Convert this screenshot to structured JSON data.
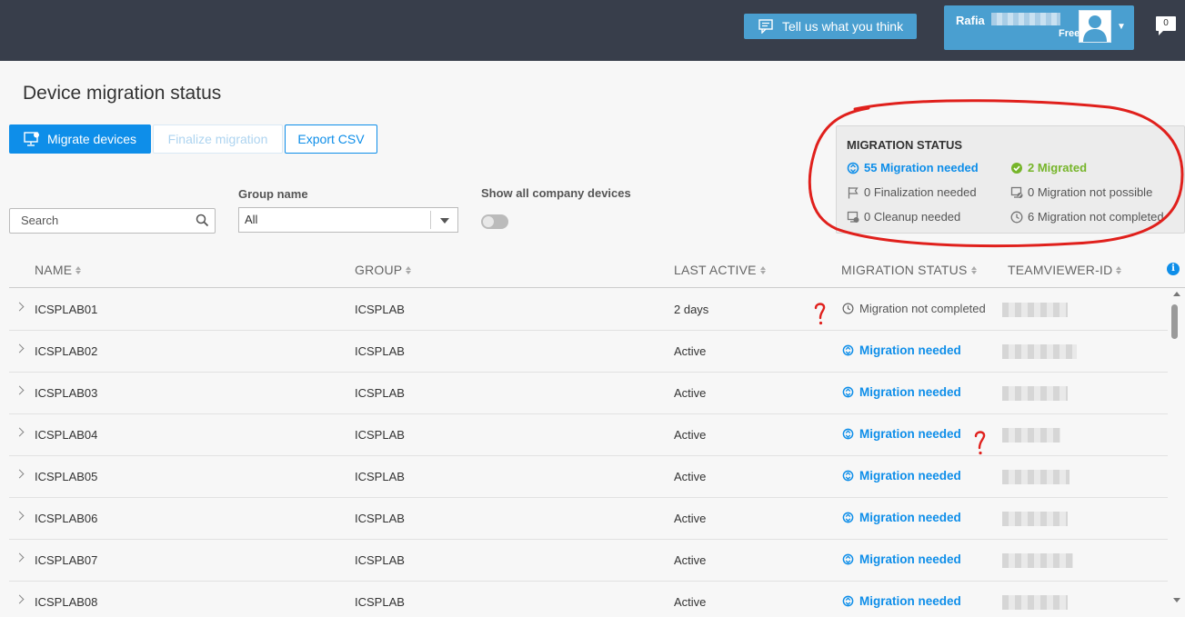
{
  "topbar": {
    "feedback_label": "Tell us what you think",
    "user_name": "Rafia",
    "plan": "Free",
    "notifications_count": "0"
  },
  "page": {
    "title": "Device migration status"
  },
  "actions": {
    "migrate_label": "Migrate devices",
    "finalize_label": "Finalize migration",
    "export_label": "Export CSV"
  },
  "filters": {
    "search_placeholder": "Search",
    "group_label": "Group name",
    "group_value": "All",
    "show_all_label": "Show all company devices",
    "show_all_on": false
  },
  "migration_status": {
    "title": "MIGRATION STATUS",
    "needed": "55 Migration needed",
    "migrated": "2 Migrated",
    "finalization": "0 Finalization needed",
    "not_possible": "0 Migration not possible",
    "cleanup": "0 Cleanup needed",
    "not_completed": "6 Migration not completed"
  },
  "table": {
    "columns": [
      "NAME",
      "GROUP",
      "LAST ACTIVE",
      "MIGRATION STATUS",
      "TEAMVIEWER-ID"
    ],
    "rows": [
      {
        "name": "ICSPLAB01",
        "group": "ICSPLAB",
        "last_active": "2 days",
        "status": "Migration not completed",
        "status_type": "notcomp"
      },
      {
        "name": "ICSPLAB02",
        "group": "ICSPLAB",
        "last_active": "Active",
        "status": "Migration needed",
        "status_type": "needed"
      },
      {
        "name": "ICSPLAB03",
        "group": "ICSPLAB",
        "last_active": "Active",
        "status": "Migration needed",
        "status_type": "needed"
      },
      {
        "name": "ICSPLAB04",
        "group": "ICSPLAB",
        "last_active": "Active",
        "status": "Migration needed",
        "status_type": "needed"
      },
      {
        "name": "ICSPLAB05",
        "group": "ICSPLAB",
        "last_active": "Active",
        "status": "Migration needed",
        "status_type": "needed"
      },
      {
        "name": "ICSPLAB06",
        "group": "ICSPLAB",
        "last_active": "Active",
        "status": "Migration needed",
        "status_type": "needed"
      },
      {
        "name": "ICSPLAB07",
        "group": "ICSPLAB",
        "last_active": "Active",
        "status": "Migration needed",
        "status_type": "needed"
      },
      {
        "name": "ICSPLAB08",
        "group": "ICSPLAB",
        "last_active": "Active",
        "status": "Migration needed",
        "status_type": "needed"
      }
    ]
  },
  "colors": {
    "topbar": "#383e4b",
    "accent": "#0e8ee9",
    "feedback": "#4a9fd0",
    "migrated_green": "#76b52a",
    "annotation_red": "#e0201c"
  },
  "icons": {
    "feedback": "feedback-icon",
    "migrate": "monitor-migrate-icon",
    "search": "search-icon",
    "needed": "sync-icon",
    "migrated": "check-circle-icon",
    "finalization": "flag-icon",
    "not_possible": "blocked-device-icon",
    "cleanup": "cleanup-icon",
    "not_completed": "clock-icon",
    "info": "info-icon"
  }
}
